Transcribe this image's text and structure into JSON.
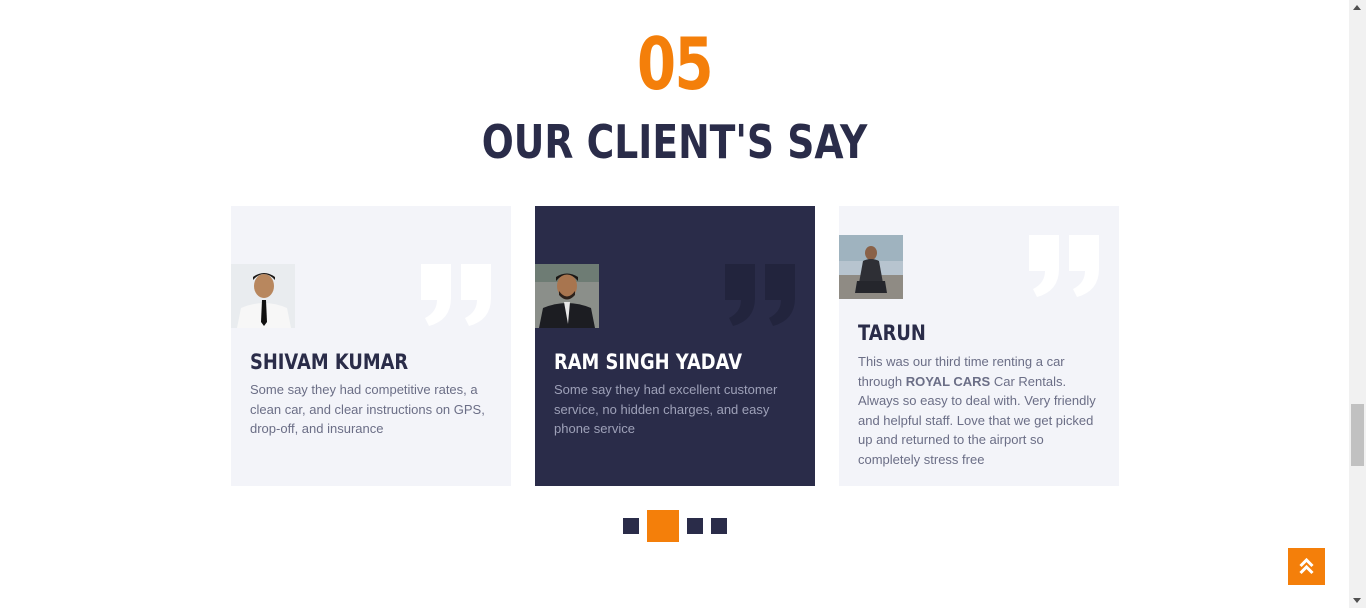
{
  "section": {
    "number": "05",
    "title": "OUR CLIENT'S SAY"
  },
  "testimonials": [
    {
      "name": "SHIVAM KUMAR",
      "text": "Some say they had competitive rates, a clean car, and clear instructions on GPS, drop-off, and insurance",
      "active": false
    },
    {
      "name": "RAM SINGH YADAV",
      "text": "Some say they had excellent customer service, no hidden charges, and easy phone service",
      "active": true
    },
    {
      "name": "TARUN",
      "text_before": "This was our third time renting a car through ",
      "text_bold": "ROYAL CARS",
      "text_after": " Car Rentals. Always so easy to deal with. Very friendly and helpful staff. Love that we get picked up and returned to the airport so completely stress free",
      "active": false
    }
  ],
  "carousel": {
    "slides": 4,
    "active_index": 1
  },
  "colors": {
    "accent": "#f47f0a",
    "dark": "#2a2c49",
    "card_bg": "#f3f4f9",
    "muted_text": "#6b6e86"
  },
  "icons": {
    "quote": "closing-quote-icon",
    "back_to_top": "double-chevron-up-icon"
  }
}
